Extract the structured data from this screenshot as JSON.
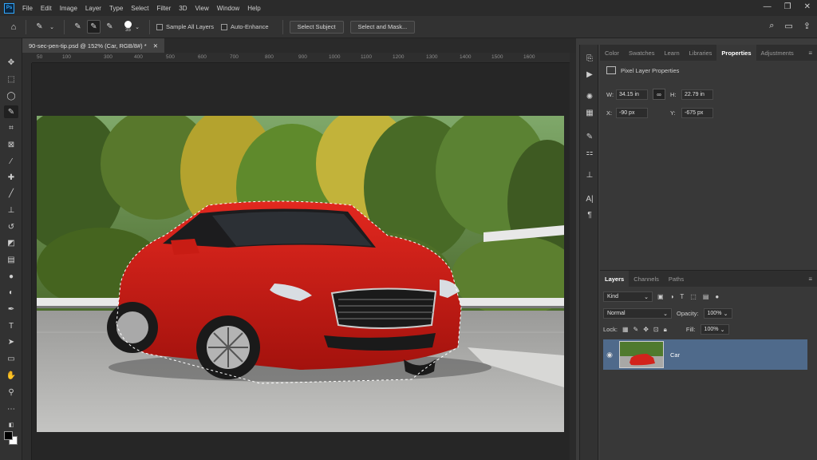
{
  "menubar": {
    "logo": "Ps",
    "items": [
      "File",
      "Edit",
      "Image",
      "Layer",
      "Type",
      "Select",
      "Filter",
      "3D",
      "View",
      "Window",
      "Help"
    ]
  },
  "options": {
    "brush_size": "35",
    "sample_all_layers": "Sample All Layers",
    "auto_enhance": "Auto-Enhance",
    "select_subject": "Select Subject",
    "select_and_mask": "Select and Mask..."
  },
  "document": {
    "tab_title": "90-sec-pen-tip.psd @ 152% (Car, RGB/8#) *",
    "ruler_labels": [
      "50",
      "100",
      "300",
      "400",
      "500",
      "600",
      "700",
      "800",
      "900",
      "1000",
      "1100",
      "1200",
      "1300",
      "1400",
      "1500",
      "1600"
    ]
  },
  "properties": {
    "tabs": [
      "Color",
      "Swatches",
      "Learn",
      "Libraries",
      "Properties",
      "Adjustments"
    ],
    "active_tab": "Properties",
    "section_title": "Pixel Layer Properties",
    "w_label": "W:",
    "w_value": "34.15 in",
    "h_label": "H:",
    "h_value": "22.79 in",
    "x_label": "X:",
    "x_value": "-90 px",
    "y_label": "Y:",
    "y_value": "-675 px"
  },
  "layers": {
    "tabs": [
      "Layers",
      "Channels",
      "Paths"
    ],
    "filter_kind": "Kind",
    "blend_mode": "Normal",
    "opacity_label": "Opacity:",
    "opacity_value": "100%",
    "lock_label": "Lock:",
    "fill_label": "Fill:",
    "fill_value": "100%",
    "items": [
      {
        "name": "Car",
        "visible": true,
        "selected": true
      }
    ]
  },
  "colors": {
    "accent": "#31a8ff",
    "selected_layer": "#4f6a8b",
    "foreground": "#000000",
    "background": "#ffffff"
  }
}
